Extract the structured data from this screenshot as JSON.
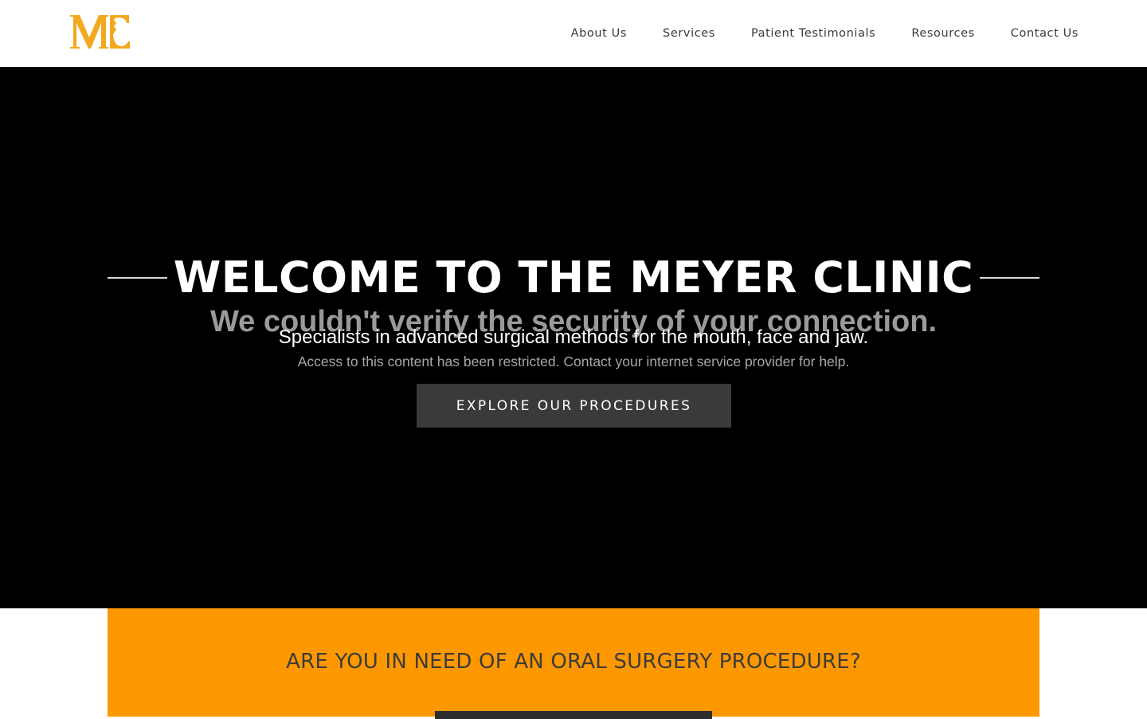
{
  "header": {
    "logo_alt": "MC",
    "nav": [
      {
        "label": "About Us"
      },
      {
        "label": "Services"
      },
      {
        "label": "Patient Testimonials"
      },
      {
        "label": "Resources"
      },
      {
        "label": "Contact Us"
      }
    ]
  },
  "hero": {
    "title": "WELCOME TO THE MEYER CLINIC",
    "subtitle": "Specialists in advanced surgical methods for the mouth, face and jaw.",
    "button_label": "EXPLORE OUR PROCEDURES"
  },
  "error_overlay": {
    "title": "We couldn't verify the security of your connection.",
    "message": "Access to this content has been restricted. Contact your internet service provider for help."
  },
  "cta": {
    "heading": "ARE YOU IN NEED OF AN ORAL SURGERY PROCEDURE?"
  },
  "colors": {
    "brand_orange": "#fe9800",
    "logo_gold": "#f2a91e",
    "hero_bg": "#000000",
    "button_dark": "#3a3a3a"
  },
  "icons": {
    "logo": "mc-monogram-logo"
  }
}
